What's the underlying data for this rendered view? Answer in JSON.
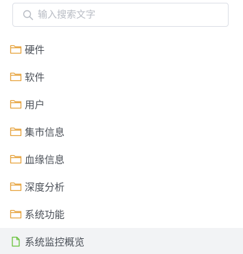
{
  "search": {
    "placeholder": "输入搜索文字",
    "value": "",
    "icon": "search-icon"
  },
  "tree": {
    "items": [
      {
        "label": "硬件",
        "icon": "folder-icon"
      },
      {
        "label": "软件",
        "icon": "folder-icon"
      },
      {
        "label": "用户",
        "icon": "folder-icon"
      },
      {
        "label": "集市信息",
        "icon": "folder-icon"
      },
      {
        "label": "血缘信息",
        "icon": "folder-icon"
      },
      {
        "label": "深度分析",
        "icon": "folder-icon"
      },
      {
        "label": "系统功能",
        "icon": "folder-icon"
      },
      {
        "label": "系统监控概览",
        "icon": "document-icon",
        "selected": true
      }
    ]
  },
  "colors": {
    "folder": "#e6a23c",
    "document": "#67c23a",
    "selected_background": "#f2f3f5",
    "text": "#4a4f57"
  }
}
